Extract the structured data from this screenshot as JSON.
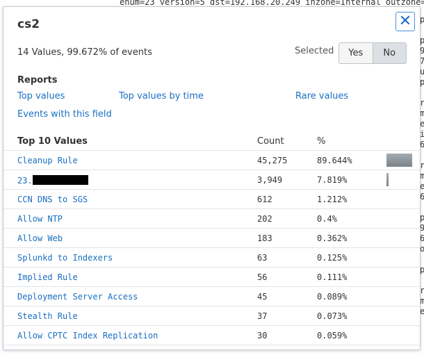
{
  "background": {
    "top_line": "enum=23 version=5 dst=192.168.20.249 inzone=Internal outzone=In",
    "right_chars": [
      "p",
      "",
      "p",
      "9",
      "7",
      "u",
      "p",
      "",
      "r",
      "m",
      "e",
      "i",
      "6",
      "",
      "r",
      "m",
      "e",
      "6",
      "",
      "p",
      "9",
      "6",
      "o",
      "",
      "p",
      "",
      "r",
      "m",
      "e"
    ],
    "bottom_line": "h... sequence_...ful  u..."
  },
  "popup": {
    "title": "cs2",
    "close_glyph": "✕",
    "summary": "14 Values, 99.672% of events",
    "selected_label": "Selected",
    "toggle": {
      "yes": "Yes",
      "no": "No",
      "active": "No"
    },
    "reports_title": "Reports",
    "links": {
      "top_values": "Top values",
      "top_values_by_time": "Top values by time",
      "rare_values": "Rare values",
      "events_with_field": "Events with this field"
    },
    "table": {
      "headers": {
        "values": "Top 10 Values",
        "count": "Count",
        "pct": "%"
      },
      "rows": [
        {
          "name": "Cleanup Rule",
          "count": "45,275",
          "pct": "89.644%",
          "fraction": 0.89644
        },
        {
          "name": "23.",
          "redacted": true,
          "count": "3,949",
          "pct": "7.819%",
          "fraction": 0.07819
        },
        {
          "name": "CCN DNS to SGS",
          "count": "612",
          "pct": "1.212%",
          "fraction": 0.01212
        },
        {
          "name": "Allow NTP",
          "count": "202",
          "pct": "0.4%",
          "fraction": 0.004
        },
        {
          "name": "Allow Web",
          "count": "183",
          "pct": "0.362%",
          "fraction": 0.00362
        },
        {
          "name": "Splunkd to Indexers",
          "count": "63",
          "pct": "0.125%",
          "fraction": 0.00125
        },
        {
          "name": "Implied Rule",
          "count": "56",
          "pct": "0.111%",
          "fraction": 0.00111
        },
        {
          "name": "Deployment Server Access",
          "count": "45",
          "pct": "0.089%",
          "fraction": 0.00089
        },
        {
          "name": "Stealth Rule",
          "count": "37",
          "pct": "0.073%",
          "fraction": 0.00073
        },
        {
          "name": "Allow CPTC Index Replication",
          "count": "30",
          "pct": "0.059%",
          "fraction": 0.00059
        }
      ]
    }
  },
  "colors": {
    "link": "#1a6fc2",
    "bar": "#8f969d",
    "border": "#c3cbd4"
  }
}
